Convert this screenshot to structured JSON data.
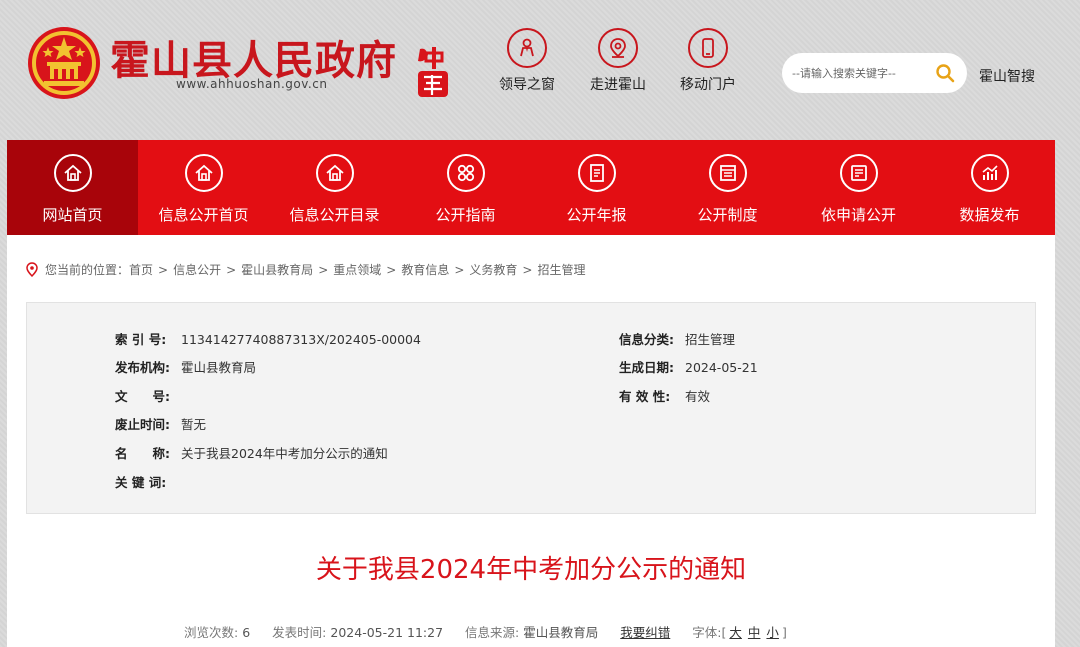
{
  "header": {
    "title": "霍山县人民政府",
    "url": "www.ahhuoshan.gov.cn",
    "quick_links": [
      {
        "label": "领导之窗",
        "icon": "leader-icon"
      },
      {
        "label": "走进霍山",
        "icon": "location-pin-icon"
      },
      {
        "label": "移动门户",
        "icon": "mobile-phone-icon"
      }
    ],
    "search_placeholder": "--请输入搜索关键字--",
    "smart_search": "霍山智搜"
  },
  "nav": {
    "items": [
      {
        "label": "网站首页",
        "icon": "home-icon",
        "active": true
      },
      {
        "label": "信息公开首页",
        "icon": "home-icon"
      },
      {
        "label": "信息公开目录",
        "icon": "home-icon"
      },
      {
        "label": "公开指南",
        "icon": "grid-icon"
      },
      {
        "label": "公开年报",
        "icon": "report-icon"
      },
      {
        "label": "公开制度",
        "icon": "document-icon"
      },
      {
        "label": "依申请公开",
        "icon": "application-icon"
      },
      {
        "label": "数据发布",
        "icon": "chart-icon"
      }
    ]
  },
  "breadcrumb": {
    "prefix": "您当前的位置：",
    "items": [
      "首页",
      "信息公开",
      "霍山县教育局",
      "重点领域",
      "教育信息",
      "义务教育",
      "招生管理"
    ]
  },
  "meta": {
    "index_label": "索 引 号:",
    "index_value": "11341427740887313X/202405-00004",
    "category_label": "信息分类:",
    "category_value": "招生管理",
    "publisher_label": "发布机构:",
    "publisher_value": "霍山县教育局",
    "date_label": "生成日期:",
    "date_value": "2024-05-21",
    "doc_no_label": "文　　号:",
    "doc_no_value": "",
    "validity_label": "有 效 性:",
    "validity_value": "有效",
    "expiry_label": "废止时间:",
    "expiry_value": "暂无",
    "name_label": "名　　称:",
    "name_value": "关于我县2024年中考加分公示的通知",
    "keywords_label": "关 键 词:",
    "keywords_value": ""
  },
  "article": {
    "title": "关于我县2024年中考加分公示的通知",
    "views_label": "浏览次数:",
    "views_value": "6",
    "publish_label": "发表时间:",
    "publish_value": "2024-05-21 11:27",
    "source_label": "信息来源:",
    "source_value": "霍山县教育局",
    "correction": "我要纠错",
    "font_label": "字体:",
    "font_open": "[",
    "font_close": "]",
    "font_sizes": [
      "大",
      "中",
      "小"
    ]
  },
  "colors": {
    "brand_red": "#e30e13",
    "active_red": "#a8040a",
    "title_red": "#d8141b"
  }
}
